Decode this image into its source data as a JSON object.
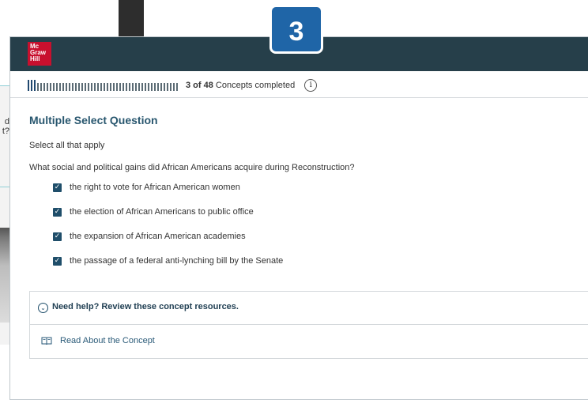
{
  "background": {
    "side_text": [
      "d",
      "t?"
    ]
  },
  "brand": {
    "logo_lines": [
      "Mc",
      "Graw",
      "Hill"
    ]
  },
  "step_badge": "3",
  "progress": {
    "current": "3 of 48",
    "suffix": "Concepts completed",
    "completed": 3,
    "total": 48,
    "info_icon": "i"
  },
  "question": {
    "title": "Multiple Select Question",
    "instruction": "Select all that apply",
    "prompt": "What social and political gains did African Americans acquire during Reconstruction?",
    "options": [
      {
        "label": "the right to vote for African American women",
        "checked": true
      },
      {
        "label": "the election of African Americans to public office",
        "checked": true
      },
      {
        "label": "the expansion of African American academies",
        "checked": true
      },
      {
        "label": "the passage of a federal anti-lynching bill by the Senate",
        "checked": true
      }
    ]
  },
  "help": {
    "toggle_label": "Need help? Review these concept resources.",
    "resource_label": "Read About the Concept"
  },
  "icons": {
    "checkbox": "check-icon",
    "help_toggle": "chevron-circle-icon",
    "resource": "book-icon",
    "info": "info-icon"
  },
  "colors": {
    "header": "#263f4a",
    "accent": "#1f4e6a",
    "badge": "#1f65a7",
    "logo": "#c8102e"
  }
}
